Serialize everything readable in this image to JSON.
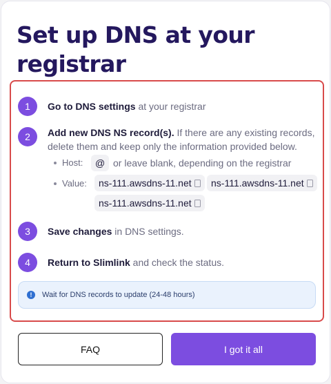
{
  "title": "Set up DNS at your registrar",
  "steps": [
    {
      "number": "1",
      "bold": "Go to DNS settings",
      "rest": " at your registrar"
    },
    {
      "number": "2",
      "bold": "Add new DNS NS record(s).",
      "rest": " If there are any existing records, delete them and keep only the information provided below."
    },
    {
      "number": "3",
      "bold": "Save changes",
      "rest": " in DNS settings."
    },
    {
      "number": "4",
      "bold": "Return to Slimlink",
      "rest": " and check the status."
    }
  ],
  "host": {
    "label": "Host:",
    "value": "@",
    "note": "or leave blank, depending on the registrar"
  },
  "value": {
    "label": "Value:",
    "entries": [
      "ns-111.awsdns-11.net",
      "ns-111.awsdns-11.net",
      "ns-111.awsdns-11.net"
    ]
  },
  "info": {
    "icon": "info-icon",
    "text": "Wait for DNS records to update (24-48 hours)",
    "color": "#2f6fd1"
  },
  "buttons": {
    "faq": "FAQ",
    "ok": "I got it all"
  },
  "colors": {
    "accent": "#7c4de0",
    "title": "#24185e",
    "highlight_border": "#d84a4a"
  }
}
